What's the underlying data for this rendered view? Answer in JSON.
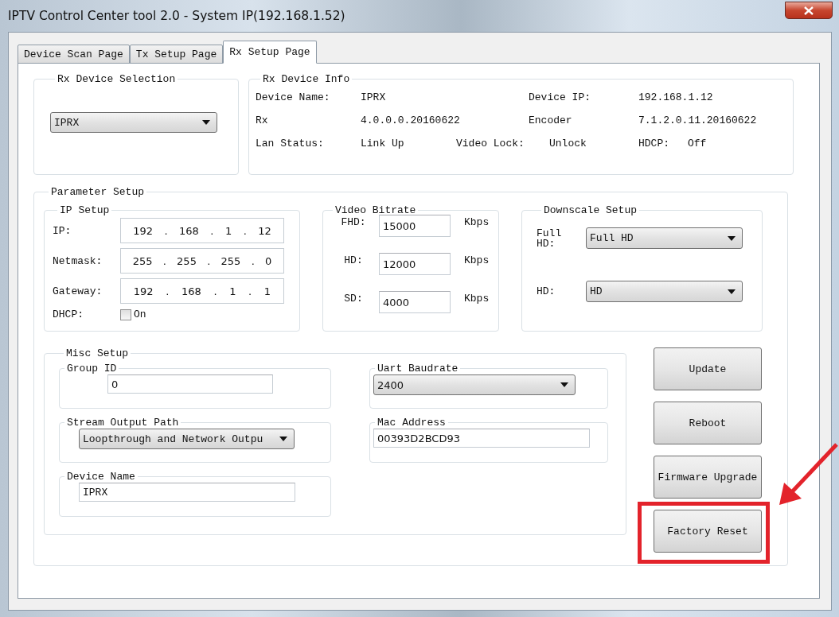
{
  "window": {
    "title": "IPTV Control Center tool 2.0 - System IP(192.168.1.52)"
  },
  "tabs": [
    {
      "label": "Device Scan Page",
      "selected": false
    },
    {
      "label": "Tx Setup Page",
      "selected": false
    },
    {
      "label": "Rx Setup Page",
      "selected": true
    }
  ],
  "device_selection": {
    "title": "Rx Device Selection",
    "value": "IPRX"
  },
  "device_info": {
    "title": "Rx Device Info",
    "rows": [
      [
        {
          "label": "Device Name:",
          "value": "IPRX"
        },
        {
          "label": "Device IP:",
          "value": "192.168.1.12"
        }
      ],
      [
        {
          "label": "Rx",
          "value": "4.0.0.0.20160622"
        },
        {
          "label": "Encoder",
          "value": "7.1.2.0.11.20160622"
        }
      ],
      [
        {
          "label": "Lan Status:",
          "value": "Link Up"
        },
        {
          "label": "Video Lock:",
          "value": "Unlock"
        },
        {
          "label": "HDCP:",
          "value": "Off"
        }
      ]
    ]
  },
  "parameter_setup": {
    "title": "Parameter Setup",
    "ip_setup": {
      "title": "IP Setup",
      "fields": [
        {
          "label": "IP:",
          "parts": [
            "192",
            ".",
            "168",
            ".",
            "1",
            ".",
            "12"
          ]
        },
        {
          "label": "Netmask:",
          "parts": [
            "255",
            ".",
            "255",
            ".",
            "255",
            ".",
            "0"
          ]
        },
        {
          "label": "Gateway:",
          "parts": [
            "192",
            ".",
            "168",
            ".",
            "1",
            ".",
            "1"
          ]
        }
      ],
      "dhcp": {
        "label": "DHCP:",
        "option": "On",
        "checked": false
      }
    },
    "video_bitrate": {
      "title": "Video Bitrate",
      "rows": [
        {
          "label": "FHD:",
          "value": "15000",
          "unit": "Kbps"
        },
        {
          "label": "HD:",
          "value": "12000",
          "unit": "Kbps"
        },
        {
          "label": "SD:",
          "value": "4000",
          "unit": "Kbps"
        }
      ]
    },
    "downscale_setup": {
      "title": "Downscale Setup",
      "rows": [
        {
          "label": "Full HD:",
          "value": "Full HD"
        },
        {
          "label": "HD:",
          "value": "HD"
        }
      ]
    },
    "misc_setup": {
      "title": "Misc Setup",
      "groups": [
        {
          "kind": "input",
          "title": "Group ID",
          "value": "0"
        },
        {
          "kind": "select",
          "title": "Uart Baudrate",
          "value": "2400"
        },
        {
          "kind": "select",
          "title": "Stream Output Path",
          "value": "Loopthrough and Network Outpu"
        },
        {
          "kind": "input",
          "title": "Mac Address",
          "value": "00393D2BCD93"
        },
        {
          "kind": "input",
          "title": "Device Name",
          "value": "IPRX"
        }
      ]
    },
    "buttons": [
      {
        "label": "Update",
        "highlighted": false
      },
      {
        "label": "Reboot",
        "highlighted": false
      },
      {
        "label": "Firmware Upgrade",
        "highlighted": false
      },
      {
        "label": "Factory Reset",
        "highlighted": true
      }
    ]
  }
}
